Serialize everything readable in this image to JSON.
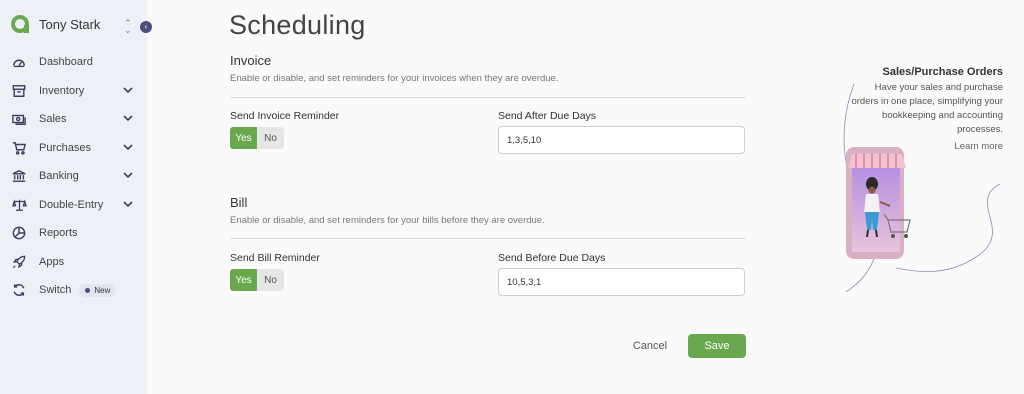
{
  "user": {
    "name": "Tony Stark"
  },
  "nav": {
    "items": [
      {
        "label": "Dashboard",
        "icon": "dashboard-icon",
        "has_submenu": false
      },
      {
        "label": "Inventory",
        "icon": "inventory-box-icon",
        "has_submenu": true
      },
      {
        "label": "Sales",
        "icon": "sales-cash-icon",
        "has_submenu": true
      },
      {
        "label": "Purchases",
        "icon": "shopping-cart-icon",
        "has_submenu": true
      },
      {
        "label": "Banking",
        "icon": "bank-icon",
        "has_submenu": true
      },
      {
        "label": "Double-Entry",
        "icon": "scale-icon",
        "has_submenu": true
      },
      {
        "label": "Reports",
        "icon": "pie-chart-icon",
        "has_submenu": false
      },
      {
        "label": "Apps",
        "icon": "rocket-icon",
        "has_submenu": false
      },
      {
        "label": "Switch",
        "icon": "switch-arrows-icon",
        "has_submenu": false,
        "badge": "New"
      }
    ]
  },
  "page": {
    "title": "Scheduling"
  },
  "invoice": {
    "title": "Invoice",
    "description": "Enable or disable, and set reminders for your invoices when they are overdue.",
    "reminder_label": "Send Invoice Reminder",
    "days_label": "Send After Due Days",
    "days_value": "1,3,5,10",
    "toggle_yes": "Yes",
    "toggle_no": "No",
    "toggle_selected": "Yes"
  },
  "bill": {
    "title": "Bill",
    "description": "Enable or disable, and set reminders for your bills before they are overdue.",
    "reminder_label": "Send Bill Reminder",
    "days_label": "Send Before Due Days",
    "days_value": "10,5,3,1",
    "toggle_yes": "Yes",
    "toggle_no": "No",
    "toggle_selected": "Yes"
  },
  "actions": {
    "cancel": "Cancel",
    "save": "Save"
  },
  "promo": {
    "title": "Sales/Purchase Orders",
    "text": "Have your sales and purchase orders in one place, simplifying your bookkeeping and accounting processes.",
    "link": "Learn more"
  },
  "colors": {
    "accent": "#6aa84f",
    "sidebar_bg": "#eef0f8",
    "nav_icon": "#3b3f5c"
  }
}
